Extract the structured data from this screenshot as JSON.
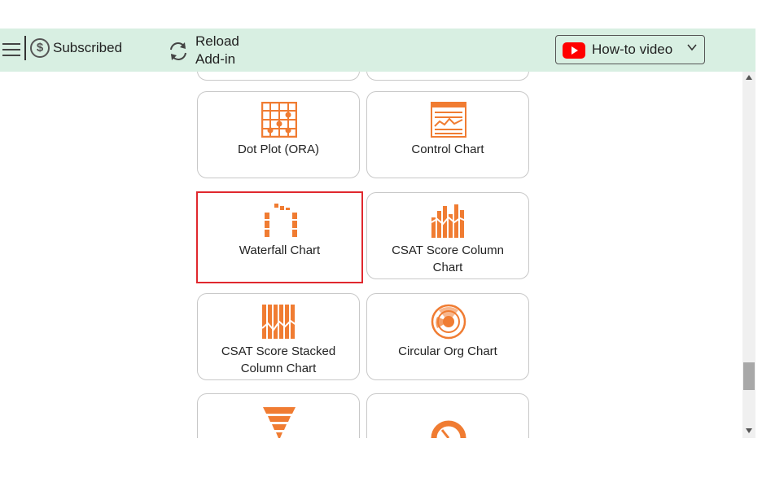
{
  "header": {
    "subscribed_label": "Subscribed",
    "reload_line1": "Reload",
    "reload_line2": "Add-in",
    "howto_label": "How-to video"
  },
  "cards": [
    {
      "label_line1": "Dot Plot (ORA)",
      "label_line2": "",
      "icon": "dot-plot-icon"
    },
    {
      "label_line1": "Control Chart",
      "label_line2": "",
      "icon": "control-chart-icon"
    },
    {
      "label_line1": "Waterfall Chart",
      "label_line2": "",
      "icon": "waterfall-chart-icon",
      "selected": true
    },
    {
      "label_line1": "CSAT Score Column",
      "label_line2": "Chart",
      "icon": "csat-column-icon"
    },
    {
      "label_line1": "CSAT Score Stacked",
      "label_line2": "Column Chart",
      "icon": "csat-stacked-icon"
    },
    {
      "label_line1": "Circular Org Chart",
      "label_line2": "",
      "icon": "circular-org-icon"
    }
  ],
  "colors": {
    "accent": "#f07c32",
    "header_bg": "#d8efe2",
    "selected_border": "#e0282e"
  }
}
